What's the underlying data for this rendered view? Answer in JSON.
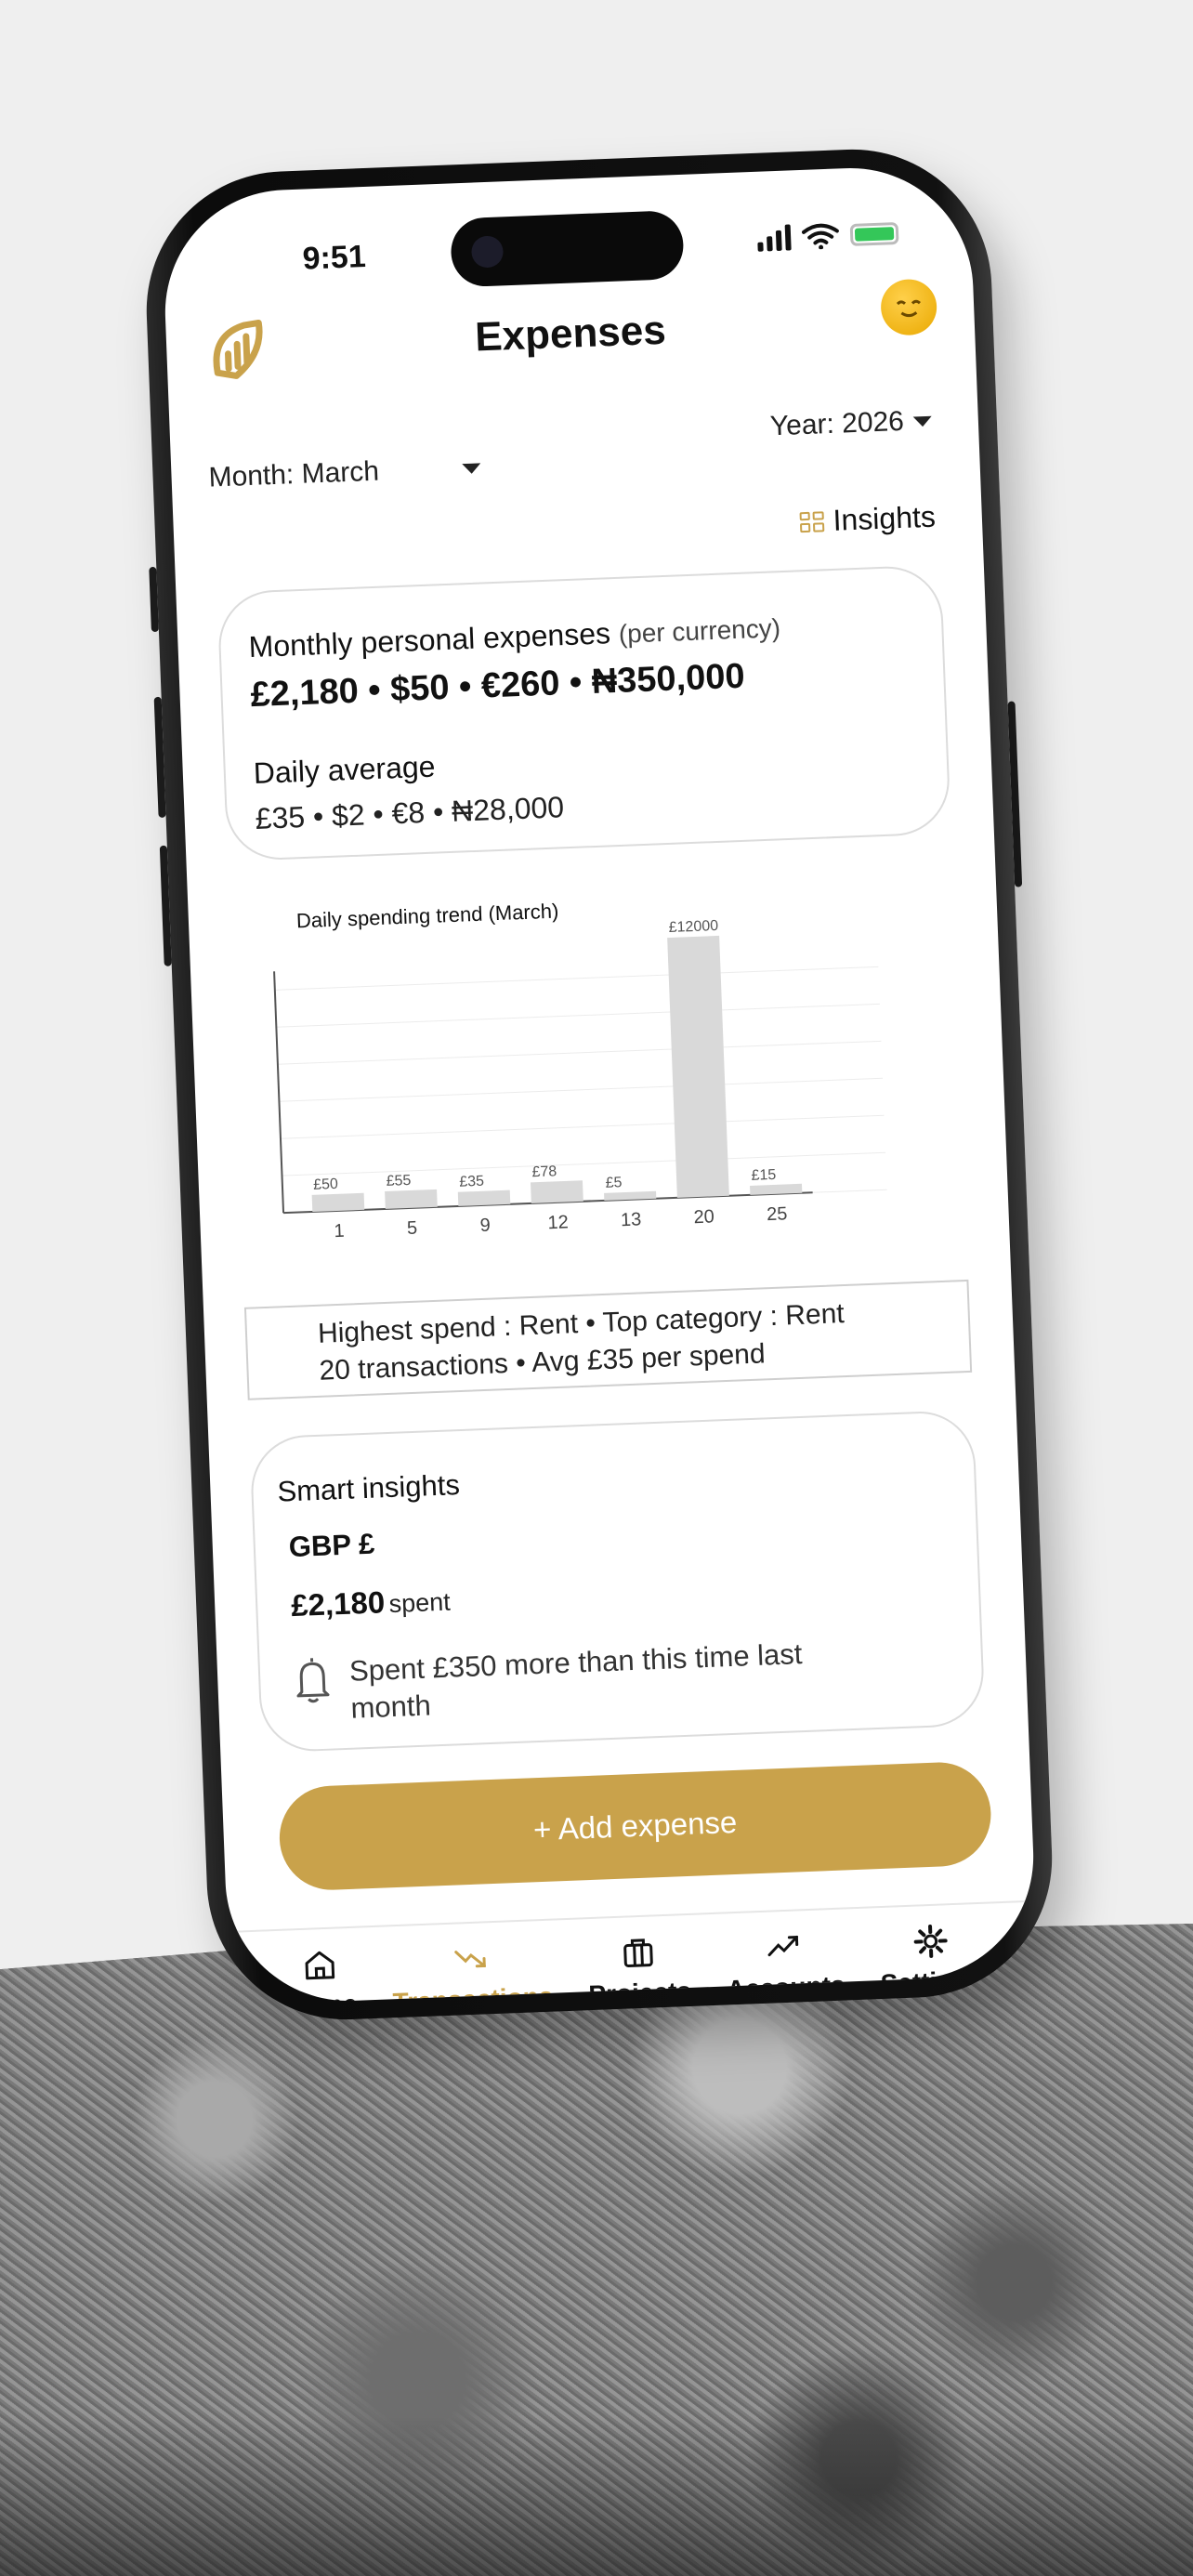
{
  "status": {
    "time": "9:51"
  },
  "header": {
    "title": "Expenses"
  },
  "filters": {
    "month_label": "Month: March",
    "year_label": "Year: 2026"
  },
  "insights_link": {
    "label": "Insights"
  },
  "monthly": {
    "label": "Monthly personal expenses",
    "label_suffix": "(per currency)",
    "value": "£2,180 • $50 • €260 • ₦350,000",
    "daily_label": "Daily average",
    "daily_value": "£35 • $2 • €8 • ₦28,000"
  },
  "chart_data": {
    "type": "bar",
    "title": "Daily spending trend (March)",
    "categories": [
      "1",
      "5",
      "9",
      "12",
      "13",
      "20",
      "25"
    ],
    "values": [
      50,
      55,
      35,
      78,
      5,
      12000,
      15
    ],
    "value_labels": [
      "£50",
      "£55",
      "£35",
      "£78",
      "£5",
      "£12000",
      "£15"
    ],
    "grid": true
  },
  "summary": {
    "line1": "Highest spend : Rent • Top category : Rent",
    "line2": "20 transactions • Avg £35 per spend"
  },
  "smart_insights": {
    "title": "Smart insights",
    "currency": "GBP £",
    "spent_value": "£2,180",
    "spent_suffix": "spent",
    "alert_icon": "bell-icon",
    "alert_text": "Spent £350 more than this time last month"
  },
  "add_button": {
    "label": "+ Add expense"
  },
  "tabs": [
    {
      "label": "Home",
      "icon": "home-icon"
    },
    {
      "label": "Transactions",
      "icon": "trending-down-icon",
      "active": true
    },
    {
      "label": "Projects",
      "icon": "briefcase-icon"
    },
    {
      "label": "Accounts",
      "icon": "trending-up-icon"
    },
    {
      "label": "Settings",
      "icon": "gear-icon"
    }
  ],
  "colors": {
    "accent": "#c9a24b",
    "bar": "#d9d9d9",
    "background": "#efefef"
  }
}
